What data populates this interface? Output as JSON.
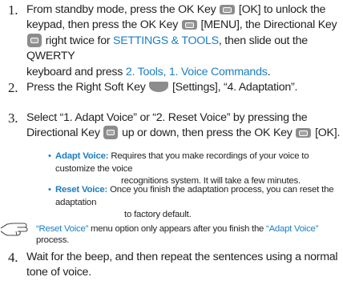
{
  "steps": [
    {
      "num": "1.",
      "l1a": "From standby mode, press the OK Key",
      "l1b": "[OK] to unlock the",
      "l2a": "keypad, then press the OK Key",
      "l2b": "[MENU], the Directional Key",
      "l3a": "right twice for",
      "l3b": "SETTINGS & TOOLS",
      "l3c": ", then slide out the QWERTY",
      "l4a": "keyboard and press",
      "l4b": "2. Tools, 1. Voice Commands",
      "l4c": "."
    },
    {
      "num": "2.",
      "l1a": "Press the Right Soft Key",
      "l1b": "[Settings], “4. Adaptation”."
    },
    {
      "num": "3.",
      "l1": "Select “1. Adapt Voice” or “2. Reset Voice” by pressing the",
      "l2a": "Directional Key",
      "l2b": "up or down, then press the OK Key",
      "l2c": "[OK]."
    },
    {
      "num": "4.",
      "l1": "Wait for the beep, and then repeat the sentences using a normal",
      "l2": "tone of voice."
    }
  ],
  "bullets": [
    {
      "term": "Adapt Voice:",
      "l1": "Requires that you make recordings of your voice to customize the voice",
      "l2": "recognitions system. It will take a few minutes."
    },
    {
      "term": "Reset Voice:",
      "l1": "Once you finish the adaptation process, you can reset the adaptation",
      "l2": "to factory default."
    }
  ],
  "note": {
    "q1": "“Reset Voice”",
    "t1": " menu option only appears after you finish the ",
    "q2": "“Adapt Voice”",
    "t2": " process."
  },
  "colors": {
    "accent": "#1b7fc0",
    "text": "#231f20",
    "key": "#8c8c8e"
  },
  "icons": {
    "ok_key": "ok-key-icon",
    "directional_key": "directional-key-icon",
    "soft_key": "right-soft-key-icon",
    "note": "note-hand-icon"
  }
}
